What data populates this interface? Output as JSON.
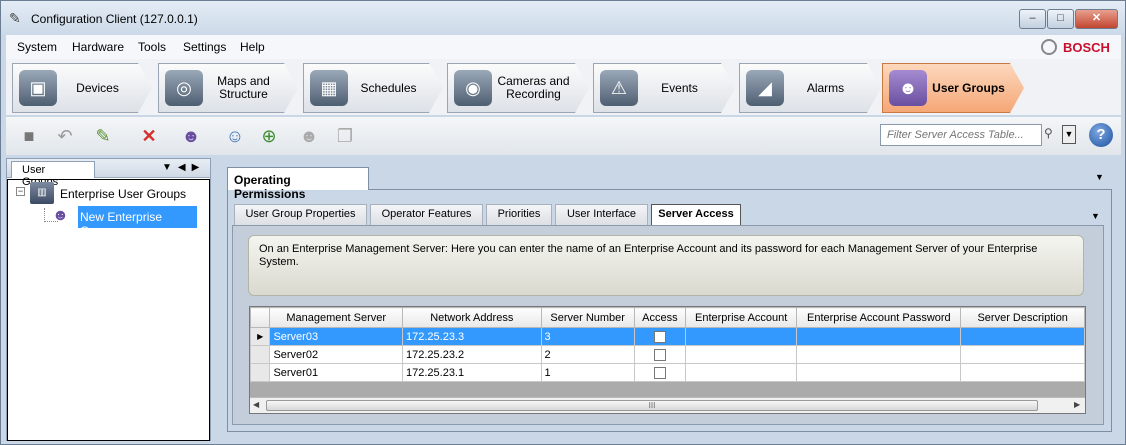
{
  "window": {
    "title": "Configuration Client (127.0.0.1)",
    "min_glyph": "–",
    "max_glyph": "□",
    "close_glyph": "✕"
  },
  "menu": {
    "items": [
      "System",
      "Hardware",
      "Tools",
      "Settings",
      "Help"
    ]
  },
  "brand": {
    "logo_text": "BOSCH",
    "color": "#c8102e"
  },
  "main_tabs": [
    {
      "label": "Devices",
      "icon": "devices-icon"
    },
    {
      "label": "Maps and Structure",
      "icon": "maps-icon"
    },
    {
      "label": "Schedules",
      "icon": "schedules-icon"
    },
    {
      "label": "Cameras and Recording",
      "icon": "cameras-icon"
    },
    {
      "label": "Events",
      "icon": "events-icon"
    },
    {
      "label": "Alarms",
      "icon": "alarms-icon"
    },
    {
      "label": "User Groups",
      "icon": "user-groups-icon",
      "active": true
    }
  ],
  "toolbar": {
    "icons": [
      "save-icon",
      "undo-icon",
      "edit-icon",
      "delete-icon",
      "new-user-group-icon",
      "new-user-icon",
      "new-dual-auth-icon",
      "new-group-pair-icon",
      "copy-icon"
    ],
    "filter_placeholder": "Filter Server Access Table...",
    "help_label": "?"
  },
  "left_panel": {
    "tab_label": "User Groups",
    "tree": {
      "root": "Enterprise User Groups",
      "children": [
        "New Enterprise Group"
      ],
      "selected": "New Enterprise Group"
    }
  },
  "content": {
    "outer_tab": "Operating Permissions",
    "sub_tabs": [
      "User Group Properties",
      "Operator Features",
      "Priorities",
      "User Interface",
      "Server Access"
    ],
    "active_sub_tab": "Server Access",
    "description": "On an Enterprise Management Server: Here you can enter the name of an Enterprise Account and its password for each Management Server of your Enterprise System.",
    "table": {
      "columns": [
        "Management Server",
        "Network Address",
        "Server Number",
        "Access",
        "Enterprise Account",
        "Enterprise Account Password",
        "Server Description"
      ],
      "rows": [
        {
          "server": "Server03",
          "address": "172.25.23.3",
          "number": "3",
          "access": false,
          "account": "",
          "password": "",
          "description": "",
          "selected": true
        },
        {
          "server": "Server02",
          "address": "172.25.23.2",
          "number": "2",
          "access": false,
          "account": "",
          "password": "",
          "description": "",
          "selected": false
        },
        {
          "server": "Server01",
          "address": "172.25.23.1",
          "number": "1",
          "access": false,
          "account": "",
          "password": "",
          "description": "",
          "selected": false
        }
      ],
      "scroll_grip": "III"
    }
  },
  "colors": {
    "selection": "#3399ff",
    "active_tab": "#f5a776"
  }
}
